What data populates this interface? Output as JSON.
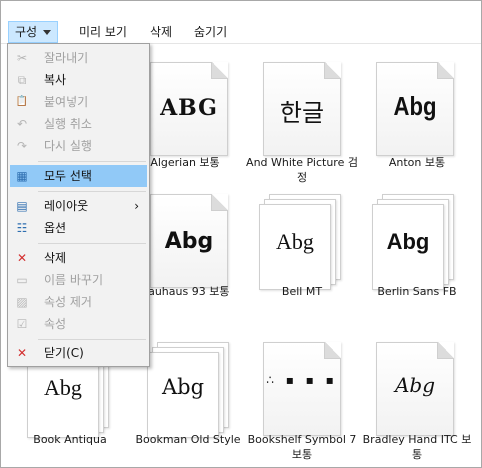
{
  "toolbar": {
    "organize": "구성",
    "preview": "미리 보기",
    "delete": "삭제",
    "hide": "숨기기"
  },
  "fonts": [
    {
      "name": "Algerian 보통",
      "sample": "ABG",
      "style": "single"
    },
    {
      "name": "And White Picture 검정",
      "sample": "한글",
      "style": "single"
    },
    {
      "name": "Anton 보통",
      "sample": "Abg",
      "style": "single"
    },
    {
      "name": "Bauhaus 93 보통",
      "sample": "Abg",
      "style": "single"
    },
    {
      "name": "Bell MT",
      "sample": "Abg",
      "style": "stack"
    },
    {
      "name": "Berlin Sans FB",
      "sample": "Abg",
      "style": "stack"
    },
    {
      "name": "Book Antiqua",
      "sample": "Abg",
      "style": "stack"
    },
    {
      "name": "Bookman Old Style",
      "sample": "Abg",
      "style": "stack"
    },
    {
      "name": "Bookshelf Symbol 7 보통",
      "sample": "∴ ▪ ▪ ▪",
      "style": "single"
    },
    {
      "name": "Bradley Hand ITC 보통",
      "sample": "Abg",
      "style": "single"
    }
  ],
  "menu": {
    "items": [
      {
        "label": "잘라내기",
        "icon": "scissors-icon",
        "glyph": "✂",
        "disabled": true
      },
      {
        "label": "복사",
        "icon": "copy-icon",
        "glyph": "⧉",
        "disabled": false
      },
      {
        "label": "붙여넣기",
        "icon": "paste-icon",
        "glyph": "📋",
        "disabled": true
      },
      {
        "label": "실행 취소",
        "icon": "undo-icon",
        "glyph": "↶",
        "disabled": true
      },
      {
        "label": "다시 실행",
        "icon": "redo-icon",
        "glyph": "↷",
        "disabled": true
      },
      {
        "label": "모두 선택",
        "icon": "select-all-icon",
        "glyph": "▦",
        "disabled": false
      },
      {
        "label": "레이아웃",
        "icon": "layout-icon",
        "glyph": "▤",
        "disabled": false,
        "submenu": "›"
      },
      {
        "label": "옵션",
        "icon": "options-icon",
        "glyph": "☷",
        "disabled": false
      },
      {
        "label": "삭제",
        "icon": "delete-x-icon",
        "glyph": "✕",
        "disabled": false
      },
      {
        "label": "이름 바꾸기",
        "icon": "rename-icon",
        "glyph": "▭",
        "disabled": true
      },
      {
        "label": "속성 제거",
        "icon": "remove-properties-icon",
        "glyph": "▨",
        "disabled": true
      },
      {
        "label": "속성",
        "icon": "properties-icon",
        "glyph": "☑",
        "disabled": true
      },
      {
        "label": "닫기(C)",
        "icon": "close-x-icon",
        "glyph": "✕",
        "disabled": false
      }
    ]
  }
}
